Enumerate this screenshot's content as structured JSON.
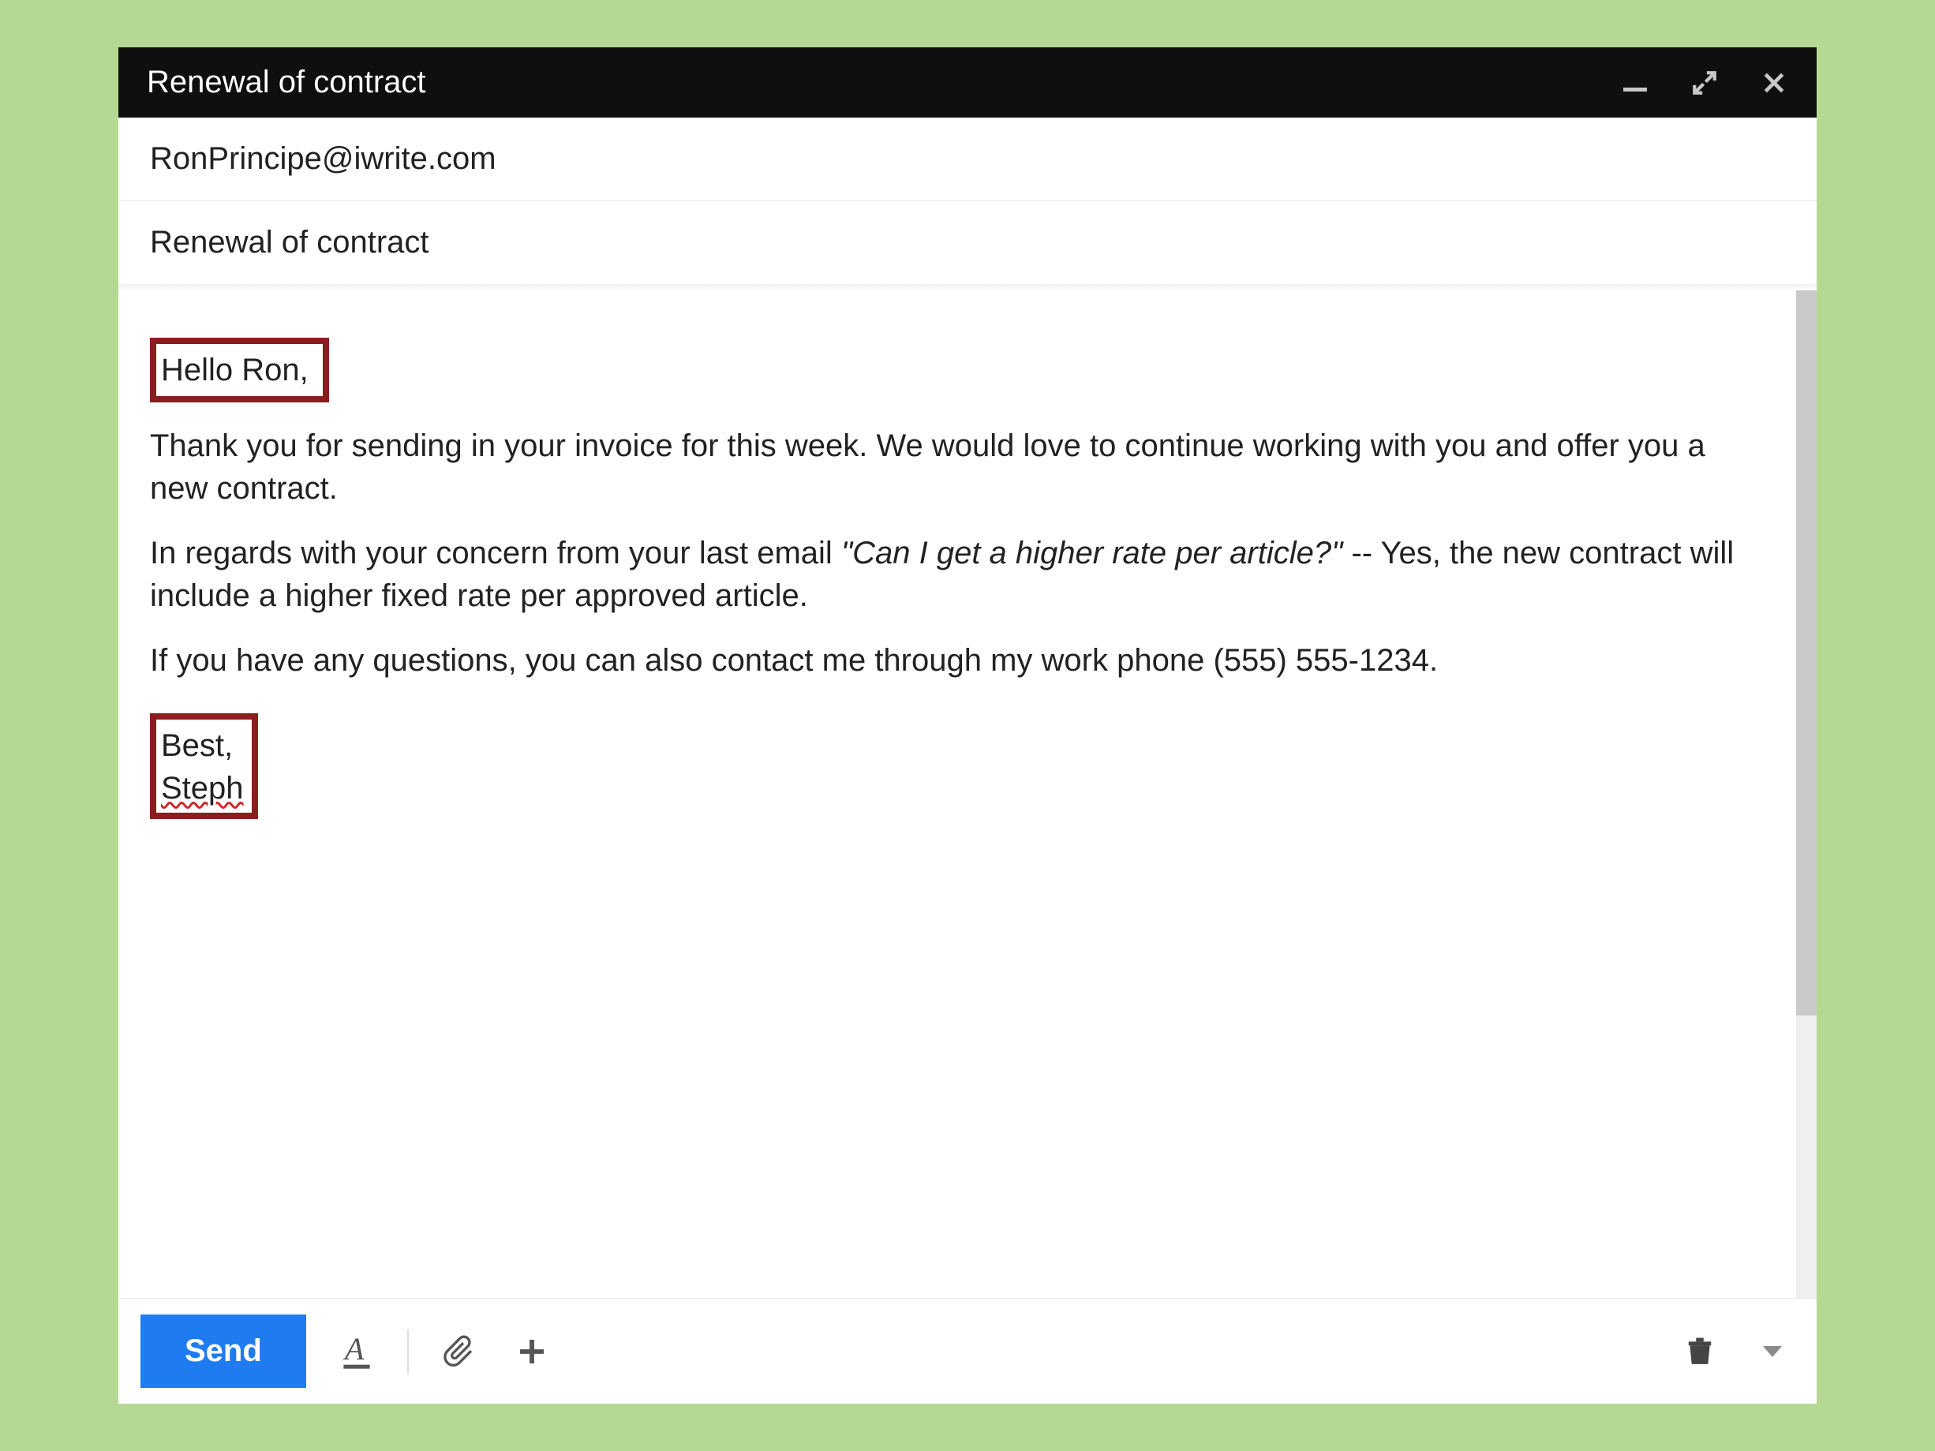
{
  "titlebar": {
    "title": "Renewal of contract"
  },
  "fields": {
    "to": "RonPrincipe@iwrite.com",
    "subject": "Renewal of contract"
  },
  "body": {
    "greeting": "Hello Ron,",
    "p1": "Thank you for sending in your invoice for this week. We would love to continue working with you and offer you a new contract.",
    "p2_prefix": "In regards with your concern from your last email ",
    "p2_quote": "\"Can I get a higher rate per article?\"",
    "p2_suffix": " -- Yes, the new contract will include a higher fixed rate per approved article.",
    "p3": "If you have any questions, you can also contact me through my work phone (555) 555-1234.",
    "closing": "Best,",
    "signature": "Steph"
  },
  "toolbar": {
    "send_label": "Send"
  }
}
